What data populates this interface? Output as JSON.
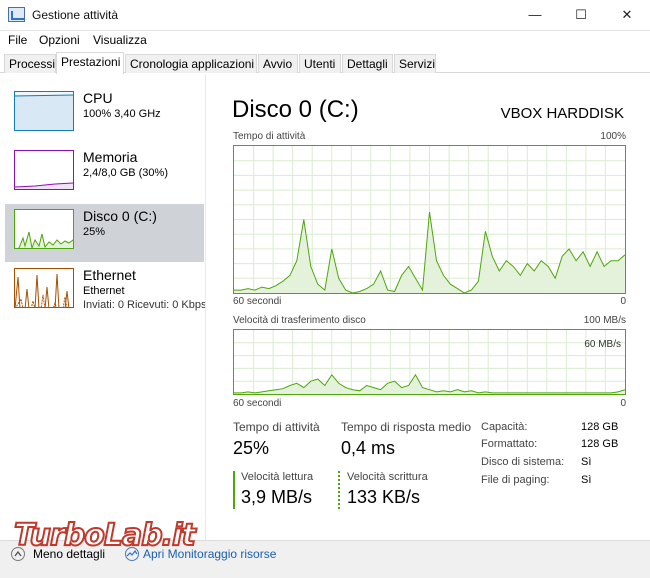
{
  "window": {
    "title": "Gestione attività",
    "controls": {
      "minimize": "—",
      "maximize": "☐",
      "close": "✕"
    }
  },
  "menu": [
    "File",
    "Opzioni",
    "Visualizza"
  ],
  "tabs": [
    {
      "label": "Processi"
    },
    {
      "label": "Prestazioni",
      "active": true
    },
    {
      "label": "Cronologia applicazioni"
    },
    {
      "label": "Avvio"
    },
    {
      "label": "Utenti"
    },
    {
      "label": "Dettagli"
    },
    {
      "label": "Servizi"
    }
  ],
  "sidebar": {
    "cpu": {
      "title": "CPU",
      "sub": "100% 3,40 GHz",
      "color": "#117dbb"
    },
    "memory": {
      "title": "Memoria",
      "sub": "2,4/8,0 GB (30%)",
      "color": "#8b12ae"
    },
    "disk": {
      "title": "Disco 0 (C:)",
      "sub": "25%",
      "color": "#4da60c"
    },
    "ethernet": {
      "title": "Ethernet",
      "sub": "Ethernet",
      "sub2": "Inviati: 0 Ricevuti: 0 Kbps",
      "color": "#a74f01"
    }
  },
  "main": {
    "title": "Disco 0 (C:)",
    "model": "VBOX HARDDISK",
    "activity_graph": {
      "label": "Tempo di attività",
      "max_label": "100%",
      "x_left": "60 secondi",
      "x_right": "0",
      "values_percent": [
        2,
        2,
        3,
        2,
        4,
        3,
        5,
        8,
        12,
        22,
        50,
        18,
        6,
        2,
        30,
        10,
        2,
        0,
        1,
        3,
        6,
        15,
        2,
        1,
        12,
        18,
        10,
        2,
        55,
        22,
        12,
        6,
        3,
        0,
        2,
        8,
        42,
        25,
        15,
        22,
        18,
        12,
        20,
        15,
        22,
        18,
        10,
        25,
        30,
        22,
        28,
        18,
        28,
        18,
        22,
        22,
        26
      ]
    },
    "transfer_graph": {
      "label": "Velocità di trasferimento disco",
      "max_label": "100 MB/s",
      "inner_label": "60 MB/s",
      "x_left": "60 secondi",
      "x_right": "0",
      "values_mbs": [
        1,
        1,
        2,
        1,
        2,
        3,
        4,
        5,
        8,
        10,
        6,
        12,
        14,
        8,
        18,
        10,
        6,
        4,
        3,
        8,
        6,
        4,
        10,
        12,
        6,
        8,
        18,
        6,
        4,
        2,
        3,
        2,
        4,
        2,
        3,
        1,
        2,
        1,
        1,
        1,
        1,
        1,
        1,
        1,
        1,
        1,
        1,
        1,
        1,
        1,
        1,
        1,
        1,
        1,
        1,
        2,
        4
      ]
    },
    "stats": {
      "activity_label": "Tempo di attività",
      "activity_value": "25%",
      "response_label": "Tempo di risposta medio",
      "response_value": "0,4 ms",
      "read_label": "Velocità lettura",
      "read_value": "3,9 MB/s",
      "write_label": "Velocità scrittura",
      "write_value": "133 KB/s"
    },
    "details": [
      {
        "label": "Capacità:",
        "value": "128 GB"
      },
      {
        "label": "Formattato:",
        "value": "128 GB"
      },
      {
        "label": "Disco di sistema:",
        "value": "Sì"
      },
      {
        "label": "File di paging:",
        "value": "Sì"
      }
    ]
  },
  "footer": {
    "less_details": "Meno dettagli",
    "open_monitor": "Apri Monitoraggio risorse"
  },
  "watermark": "TurboLab.it"
}
